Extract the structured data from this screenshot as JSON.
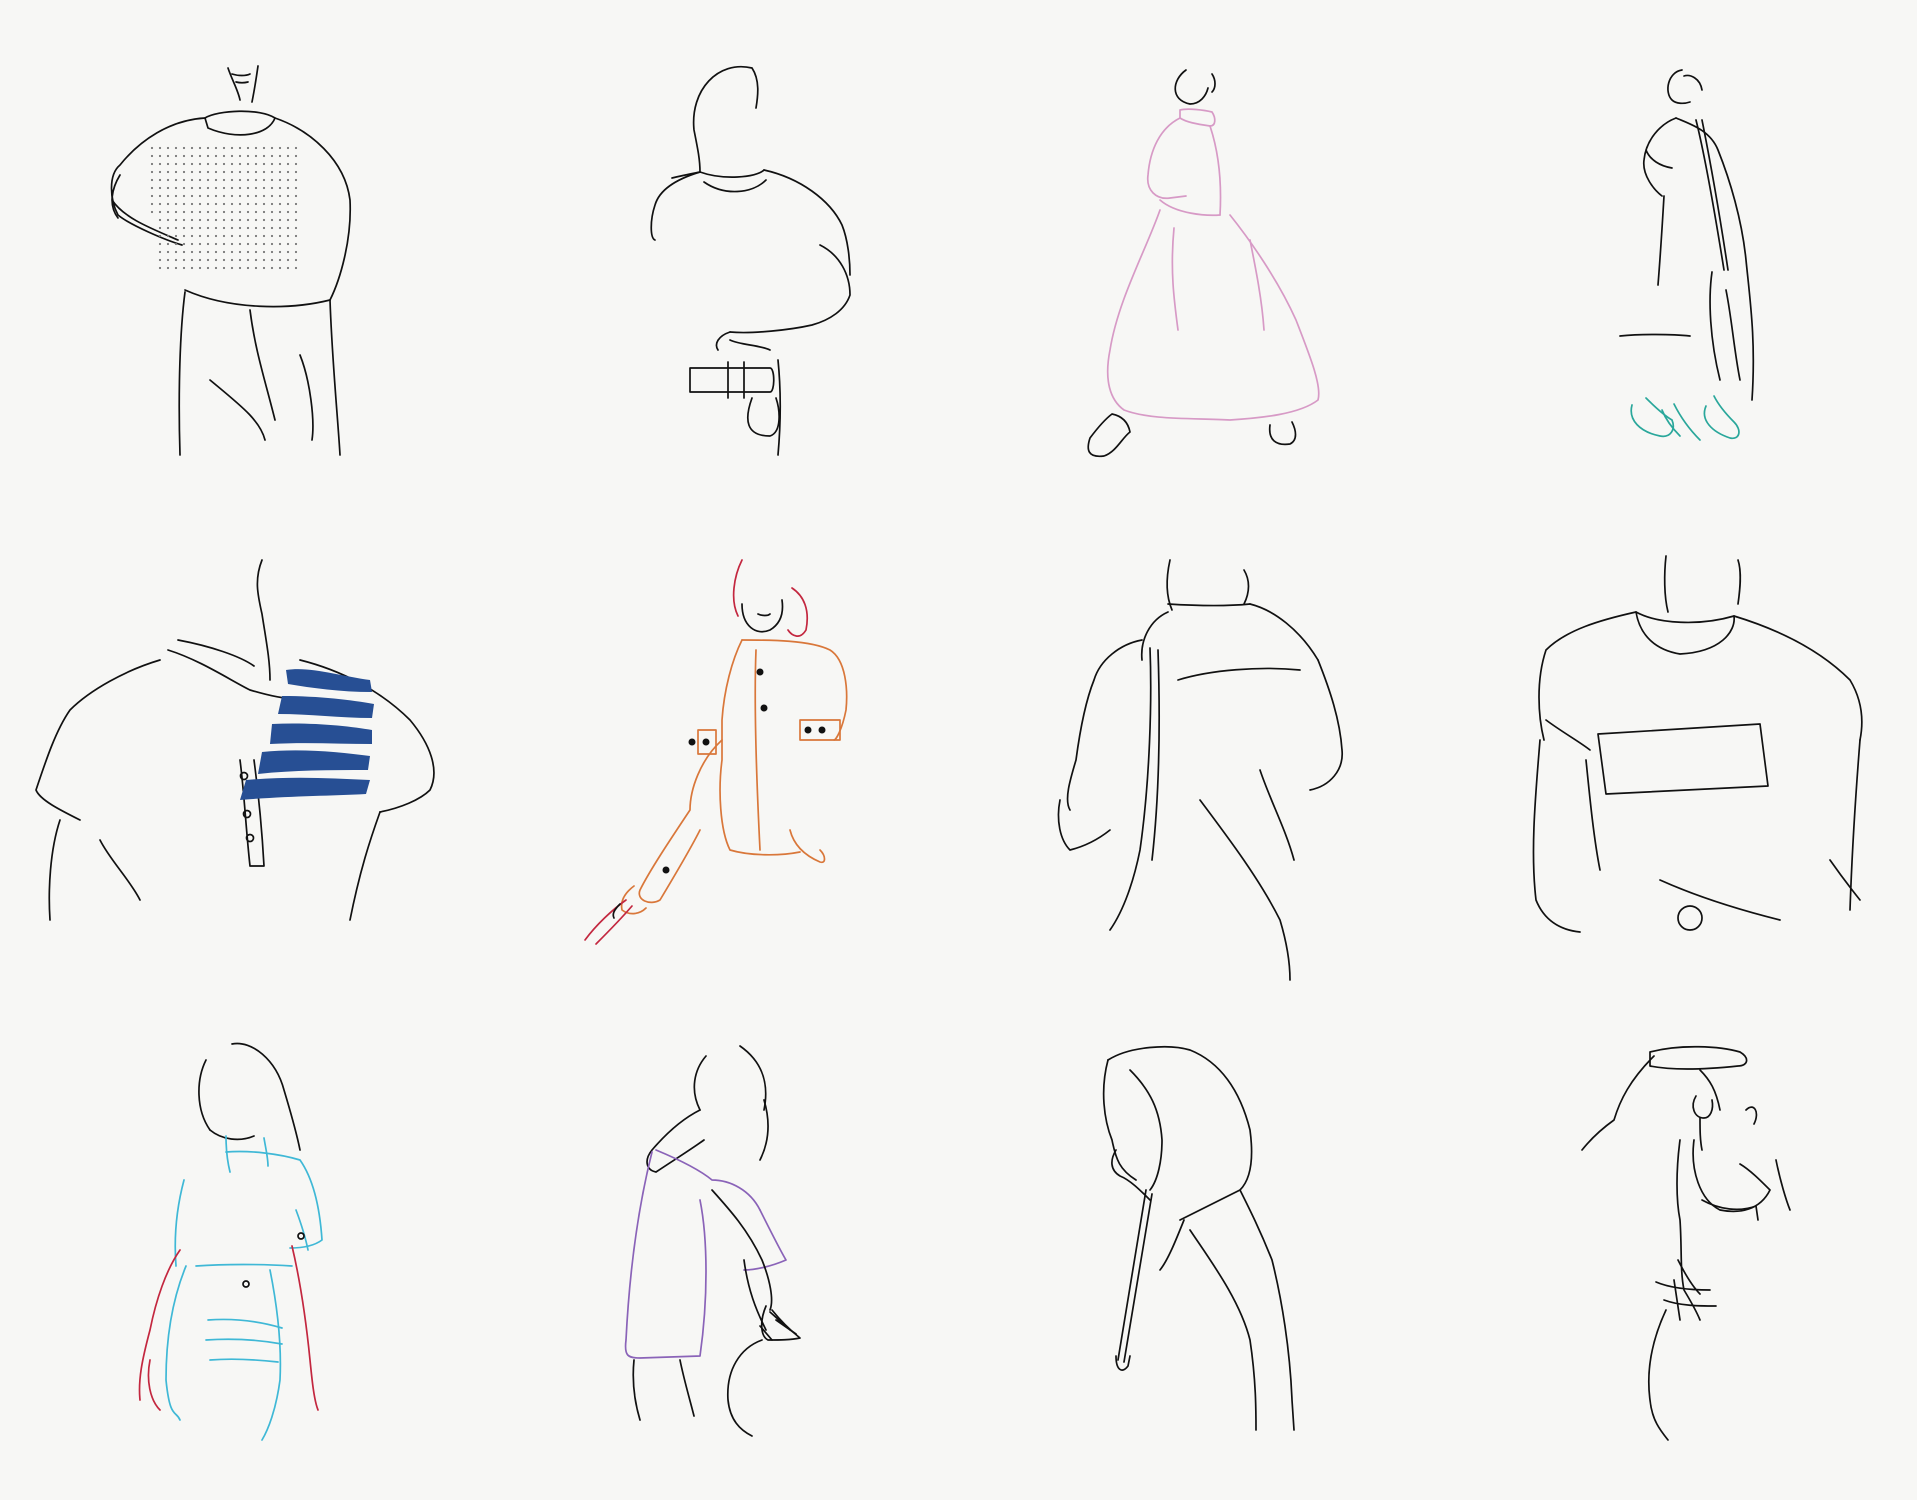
{
  "palette": {
    "background": "#f7f7f5",
    "ink": "#111111",
    "pink": "#d79ac6",
    "teal": "#2aa79b",
    "navy": "#274f94",
    "orange": "#d9773a",
    "crimson": "#c3273f",
    "cyan": "#3fb8d6",
    "violet": "#8a63b8"
  },
  "illustrations": [
    {
      "id": "knit-sweater",
      "accent": "ink",
      "pattern": "dotted-knit"
    },
    {
      "id": "tee-with-belt",
      "accent": "ink"
    },
    {
      "id": "long-dress",
      "accent": "pink"
    },
    {
      "id": "long-coat-heels",
      "accent": "teal"
    },
    {
      "id": "striped-henley",
      "accent": "navy"
    },
    {
      "id": "buttoned-jacket",
      "accent": "orange"
    },
    {
      "id": "shirt-backpack",
      "accent": "ink"
    },
    {
      "id": "tee-chest-panel",
      "accent": "ink"
    },
    {
      "id": "blouse-skirt",
      "accent": "cyan"
    },
    {
      "id": "skirt-sandal",
      "accent": "violet"
    },
    {
      "id": "hooded-top",
      "accent": "ink"
    },
    {
      "id": "hand-on-head",
      "accent": "ink"
    }
  ]
}
